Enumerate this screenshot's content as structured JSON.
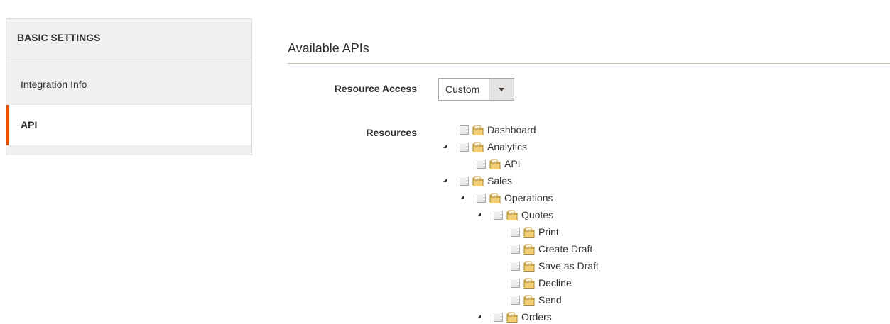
{
  "sidebar": {
    "heading": "BASIC SETTINGS",
    "items": [
      {
        "label": "Integration Info",
        "active": false
      },
      {
        "label": "API",
        "active": true
      }
    ],
    "active_color": "#eb5202"
  },
  "main": {
    "section_title": "Available APIs",
    "resource_access_label": "Resource Access",
    "resource_access_value": "Custom",
    "resources_label": "Resources"
  },
  "tree": [
    {
      "label": "Dashboard",
      "expanded": false,
      "checked": false
    },
    {
      "label": "Analytics",
      "expanded": true,
      "checked": false
    },
    {
      "label": "API",
      "expanded": false,
      "checked": false
    },
    {
      "label": "Sales",
      "expanded": true,
      "checked": false
    },
    {
      "label": "Operations",
      "expanded": true,
      "checked": false
    },
    {
      "label": "Quotes",
      "expanded": true,
      "checked": false
    },
    {
      "label": "Print",
      "expanded": false,
      "checked": false
    },
    {
      "label": "Create Draft",
      "expanded": false,
      "checked": false
    },
    {
      "label": "Save as Draft",
      "expanded": false,
      "checked": false
    },
    {
      "label": "Decline",
      "expanded": false,
      "checked": false
    },
    {
      "label": "Send",
      "expanded": false,
      "checked": false
    },
    {
      "label": "Orders",
      "expanded": true,
      "checked": false
    }
  ]
}
